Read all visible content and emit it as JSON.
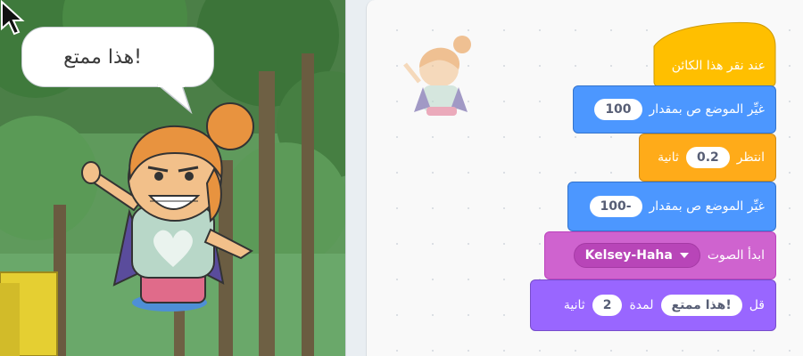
{
  "stage": {
    "speech_bubble": "هذا ممتع!",
    "sprite_icon": "kelsey-sprite",
    "cursor_icon": "mouse-pointer-icon"
  },
  "workspace": {
    "ghost_sprite_icon": "kelsey-sprite-thumbnail",
    "blocks": {
      "hat_label": "عند نقر هذا الكائن",
      "change_y_label": "غيِّر الموضع ص بمقدار",
      "change_y_value_1": "100",
      "wait_label": "انتظر",
      "wait_value": "0.2",
      "wait_unit": "ثانية",
      "change_y_value_2": "-100",
      "sound_label": "ابدأ الصوت",
      "sound_value": "Kelsey-Haha",
      "say_label": "قل",
      "say_text": "هذا ممتع!",
      "say_for": "لمدة",
      "say_secs": "2",
      "say_unit": "ثانية"
    }
  },
  "colors": {
    "motion": "#4c97ff",
    "control": "#ffab19",
    "events": "#ffbf00",
    "sound": "#cf63cf",
    "looks": "#9966ff"
  }
}
